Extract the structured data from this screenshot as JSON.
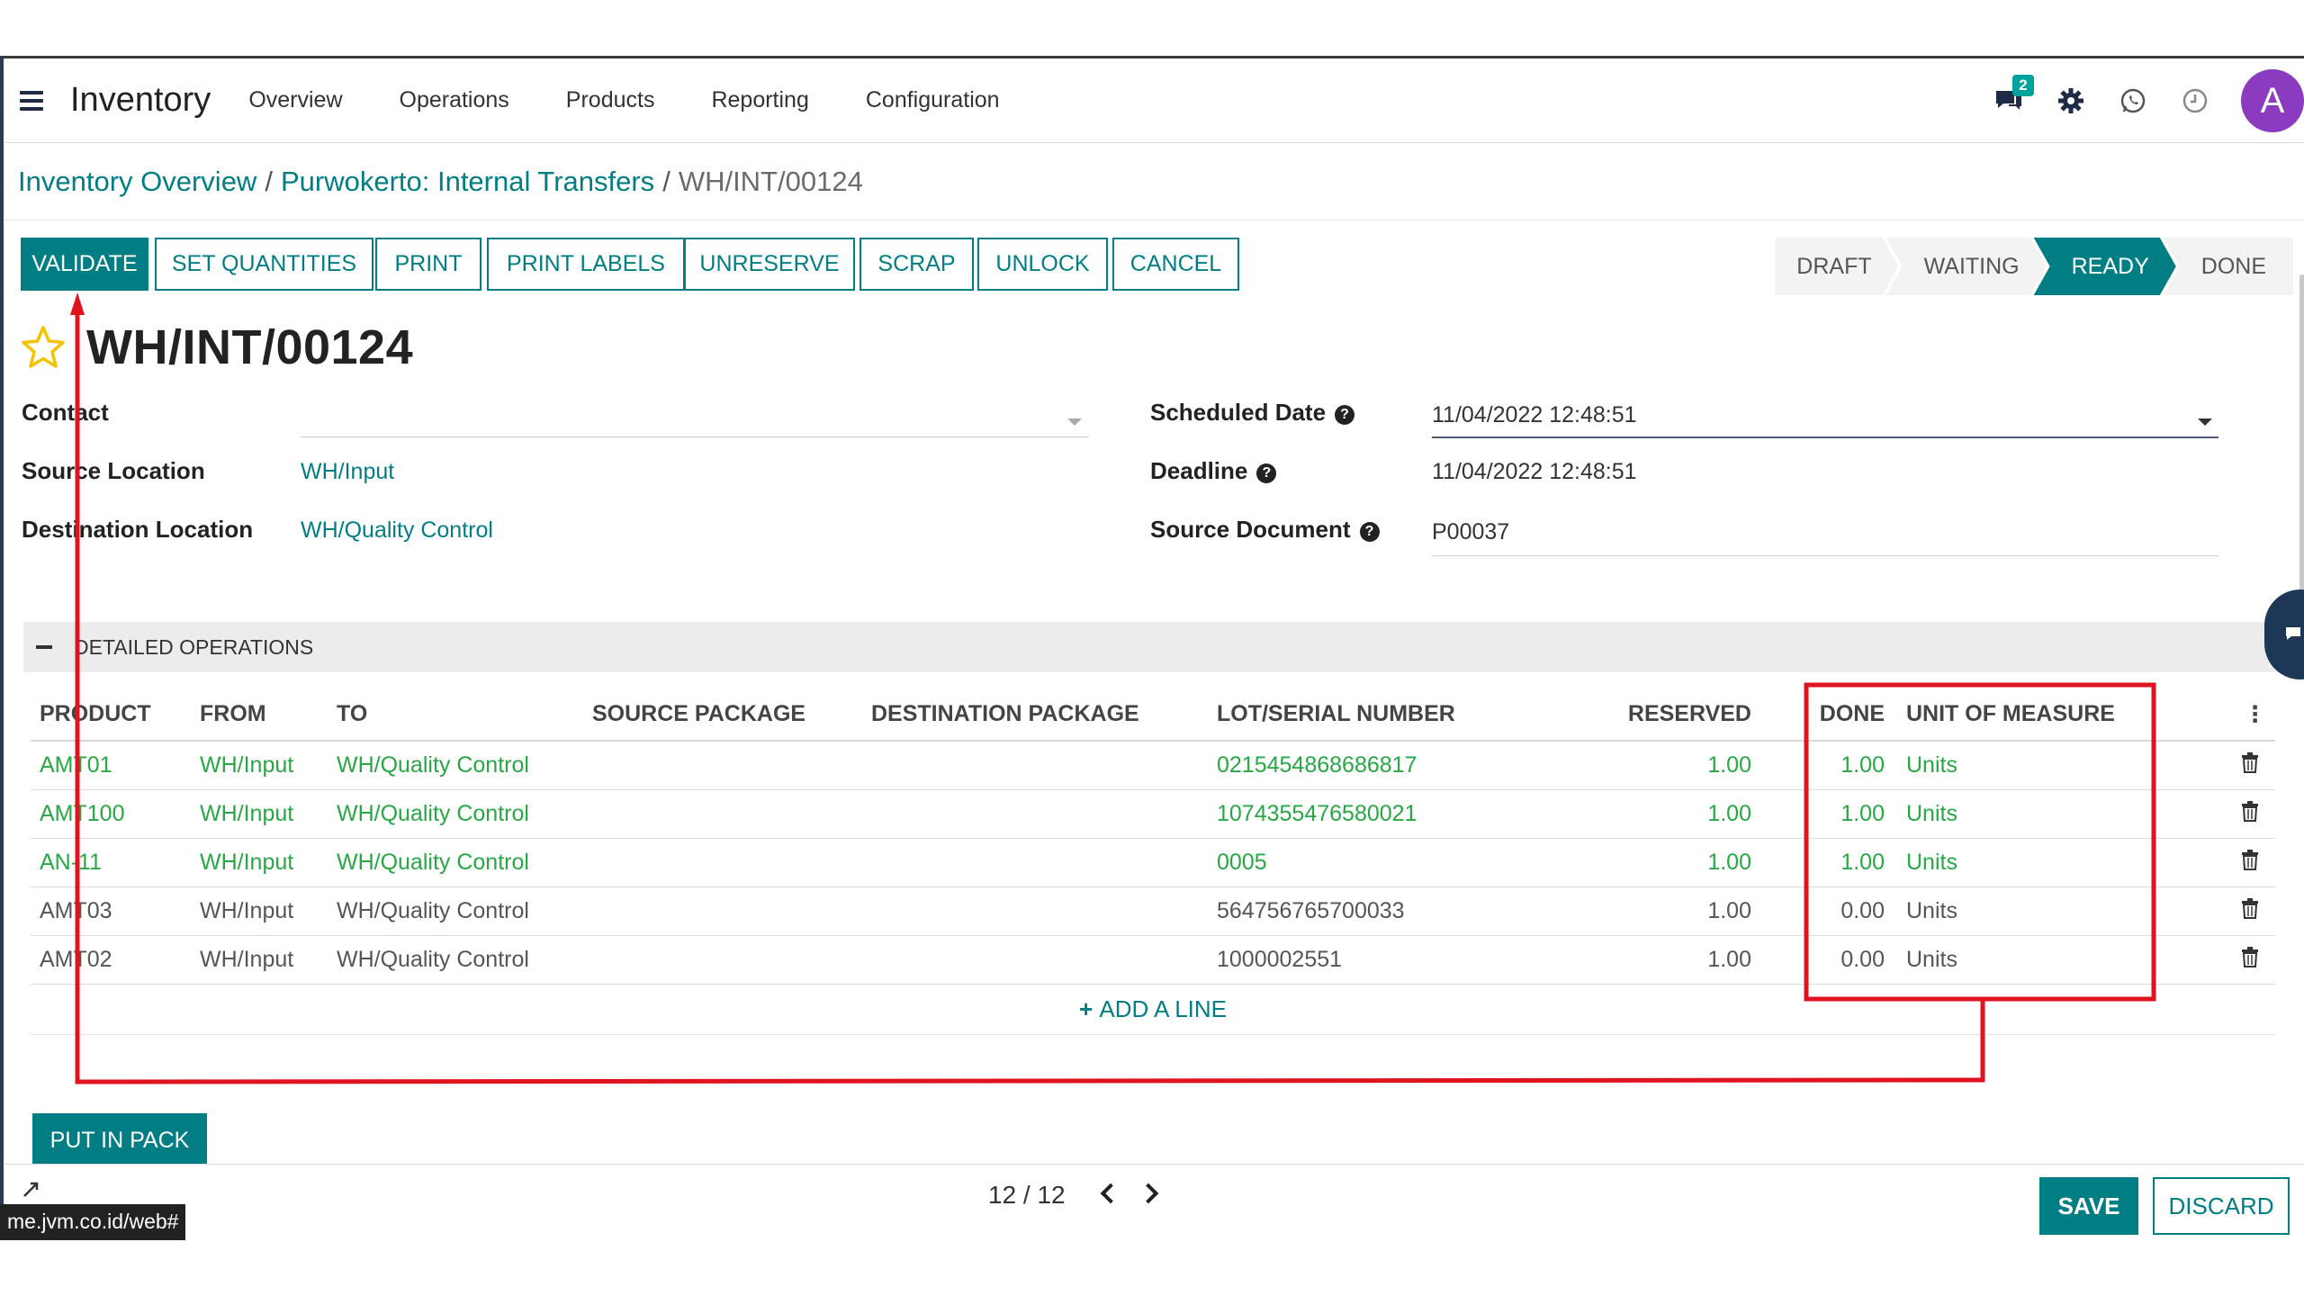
{
  "navbar": {
    "app_title": "Inventory",
    "menu": [
      "Overview",
      "Operations",
      "Products",
      "Reporting",
      "Configuration"
    ],
    "messages_badge": "2",
    "avatar_letter": "A"
  },
  "breadcrumb": {
    "items": [
      "Inventory Overview",
      "Purwokerto: Internal Transfers"
    ],
    "current": "WH/INT/00124",
    "separator": "/"
  },
  "actions": {
    "validate": "VALIDATE",
    "set_quantities": "SET QUANTITIES",
    "print": "PRINT",
    "print_labels": "PRINT LABELS",
    "unreserve": "UNRESERVE",
    "scrap": "SCRAP",
    "unlock": "UNLOCK",
    "cancel": "CANCEL"
  },
  "status": {
    "stages": [
      "DRAFT",
      "WAITING",
      "READY",
      "DONE"
    ],
    "active": "READY"
  },
  "record": {
    "title": "WH/INT/00124"
  },
  "fields": {
    "contact_label": "Contact",
    "contact_value": "",
    "source_location_label": "Source Location",
    "source_location_value": "WH/Input",
    "destination_location_label": "Destination Location",
    "destination_location_value": "WH/Quality Control",
    "scheduled_date_label": "Scheduled Date",
    "scheduled_date_value": "11/04/2022 12:48:51",
    "deadline_label": "Deadline",
    "deadline_value": "11/04/2022 12:48:51",
    "source_document_label": "Source Document",
    "source_document_value": "P00037"
  },
  "section": {
    "title": "DETAILED OPERATIONS"
  },
  "table": {
    "columns": [
      "PRODUCT",
      "FROM",
      "TO",
      "SOURCE PACKAGE",
      "DESTINATION PACKAGE",
      "LOT/SERIAL NUMBER",
      "RESERVED",
      "DONE",
      "UNIT OF MEASURE"
    ],
    "rows": [
      {
        "product": "AMT01",
        "from": "WH/Input",
        "to": "WH/Quality Control",
        "src_pkg": "",
        "dst_pkg": "",
        "lot": "0215454868686817",
        "reserved": "1.00",
        "done": "1.00",
        "uom": "Units"
      },
      {
        "product": "AMT100",
        "from": "WH/Input",
        "to": "WH/Quality Control",
        "src_pkg": "",
        "dst_pkg": "",
        "lot": "1074355476580021",
        "reserved": "1.00",
        "done": "1.00",
        "uom": "Units"
      },
      {
        "product": "AN-11",
        "from": "WH/Input",
        "to": "WH/Quality Control",
        "src_pkg": "",
        "dst_pkg": "",
        "lot": "0005",
        "reserved": "1.00",
        "done": "1.00",
        "uom": "Units"
      },
      {
        "product": "AMT03",
        "from": "WH/Input",
        "to": "WH/Quality Control",
        "src_pkg": "",
        "dst_pkg": "",
        "lot": "564756765700033",
        "reserved": "1.00",
        "done": "0.00",
        "uom": "Units"
      },
      {
        "product": "AMT02",
        "from": "WH/Input",
        "to": "WH/Quality Control",
        "src_pkg": "",
        "dst_pkg": "",
        "lot": "1000002551",
        "reserved": "1.00",
        "done": "0.00",
        "uom": "Units"
      }
    ],
    "add_line": "ADD A LINE"
  },
  "put_in_pack": "PUT IN PACK",
  "footer": {
    "pager": "12 / 12",
    "save": "SAVE",
    "discard": "DISCARD"
  },
  "status_url": "me.jvm.co.id/web#",
  "colors": {
    "primary": "#017e84",
    "reserved_green": "#28a745",
    "annotation_red": "#e0141e",
    "avatar": "#8b3bbf"
  }
}
